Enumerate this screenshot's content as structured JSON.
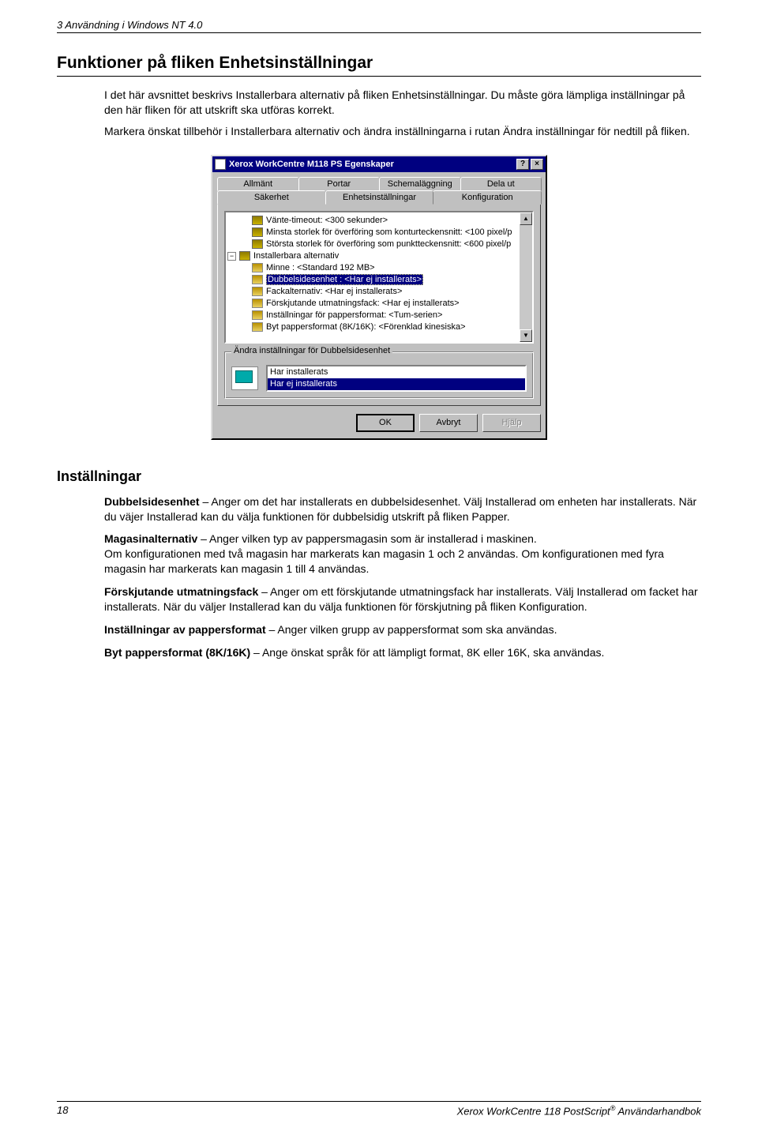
{
  "header": {
    "running": "3  Användning i Windows NT 4.0"
  },
  "h1": "Funktioner på fliken Enhetsinställningar",
  "intro": {
    "p1": "I det här avsnittet beskrivs Installerbara alternativ på fliken Enhetsinställningar. Du måste göra lämpliga inställningar på den här fliken för att utskrift ska utföras korrekt.",
    "p2": "Markera önskat tillbehör i Installerbara alternativ och ändra inställningarna i rutan Ändra inställningar för nedtill på fliken."
  },
  "dialog": {
    "title": "Xerox WorkCentre M118 PS Egenskaper",
    "help_btn": "?",
    "close_btn": "×",
    "tabs_back": [
      "Allmänt",
      "Portar",
      "Schemaläggning",
      "Dela ut"
    ],
    "tabs_front": [
      "Säkerhet",
      "Enhetsinställningar",
      "Konfiguration"
    ],
    "active_tab": "Enhetsinställningar",
    "tree": [
      {
        "indent": 1,
        "icon": "chip",
        "label": "Vänte-timeout: <300 sekunder>"
      },
      {
        "indent": 1,
        "icon": "chip",
        "label": "Minsta storlek för överföring som konturteckensnitt: <100 pixel/p"
      },
      {
        "indent": 1,
        "icon": "chip",
        "label": "Största storlek för överföring som punktteckensnitt: <600 pixel/p"
      },
      {
        "indent": 0,
        "toggle": "−",
        "icon": "chip",
        "label": "Installerbara alternativ"
      },
      {
        "indent": 1,
        "icon": "leaf",
        "label": "Minne : <Standard 192 MB>"
      },
      {
        "indent": 1,
        "icon": "leaf",
        "label": "Dubbelsidesenhet : <Har ej installerats>",
        "selected": true
      },
      {
        "indent": 1,
        "icon": "leaf",
        "label": "Fackalternativ: <Har ej installerats>"
      },
      {
        "indent": 1,
        "icon": "leaf",
        "label": "Förskjutande utmatningsfack: <Har ej installerats>"
      },
      {
        "indent": 1,
        "icon": "leaf",
        "label": "Inställningar för pappersformat: <Tum-serien>"
      },
      {
        "indent": 1,
        "icon": "leaf",
        "label": "Byt pappersformat (8K/16K): <Förenklad kinesiska>"
      }
    ],
    "groupbox_title": "Ändra inställningar för Dubbelsidesenhet",
    "list_options": [
      "Har installerats",
      "Har ej installerats"
    ],
    "list_selected_index": 1,
    "buttons": {
      "ok": "OK",
      "cancel": "Avbryt",
      "help": "Hjälp"
    }
  },
  "h2": "Inställningar",
  "settings": {
    "p1_bold": "Dubbelsidesenhet",
    "p1_rest": " – Anger om det har installerats en dubbelsidesenhet. Välj Installerad om enheten har installerats. När du väjer Installerad kan du välja funktionen för dubbelsidig utskrift på fliken Papper.",
    "p2_bold": "Magasinalternativ",
    "p2_rest": " – Anger vilken typ av pappersmagasin som är installerad i maskinen.",
    "p2_l2": "Om konfigurationen med två magasin har markerats kan magasin 1 och 2 användas. Om konfigurationen med fyra magasin har markerats kan magasin 1 till 4 användas.",
    "p3_bold": "Förskjutande utmatningsfack",
    "p3_rest": " – Anger om ett förskjutande utmatningsfack har installerats. Välj Installerad om facket har installerats. När du väljer Installerad kan du välja funktionen för förskjutning på fliken Konfiguration.",
    "p4_bold": "Inställningar av pappersformat",
    "p4_rest": " – Anger vilken grupp av pappersformat som ska användas.",
    "p5_bold": "Byt pappersformat (8K/16K)",
    "p5_rest": " – Ange önskat språk för att lämpligt format, 8K eller 16K, ska användas."
  },
  "footer": {
    "page": "18",
    "book_pre": "Xerox WorkCentre 118 PostScript",
    "book_sup": "®",
    "book_post": " Användarhandbok"
  }
}
